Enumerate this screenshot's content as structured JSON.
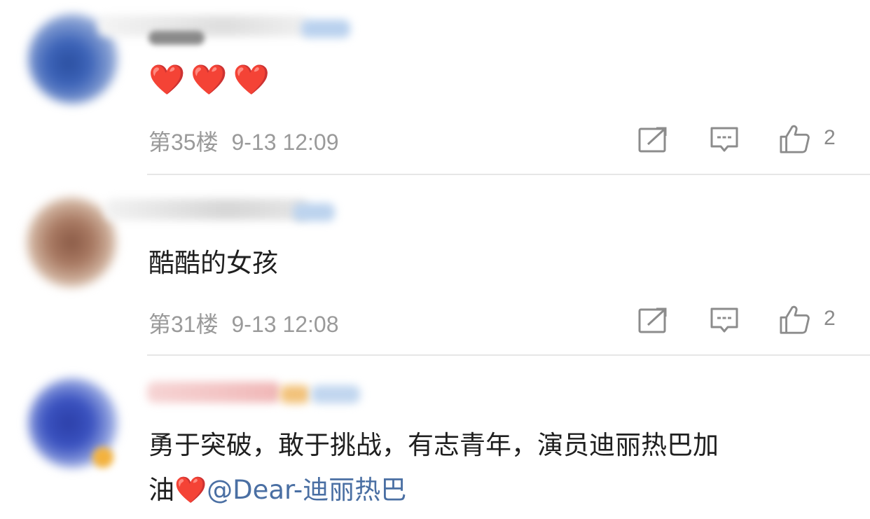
{
  "comments": [
    {
      "content": "❤️❤️❤️",
      "floor": "第35楼",
      "time": "9-13 12:09",
      "likes": "2"
    },
    {
      "content": "酷酷的女孩",
      "floor": "第31楼",
      "time": "9-13 12:08",
      "likes": "2"
    },
    {
      "content_line1": "勇于突破，敢于挑战，有志青年，演员迪丽热巴加",
      "content_line2": "油",
      "heart": "❤️",
      "mention": "@Dear-迪丽热巴"
    }
  ],
  "icons": {
    "share": "share-icon",
    "reply": "comment-icon",
    "like": "thumbs-up-icon"
  },
  "colors": {
    "text": "#1f1f1f",
    "meta": "#9a9a9a",
    "mention": "#4a6fa3",
    "heart": "#e8312a",
    "divider": "#e6e6e6"
  }
}
